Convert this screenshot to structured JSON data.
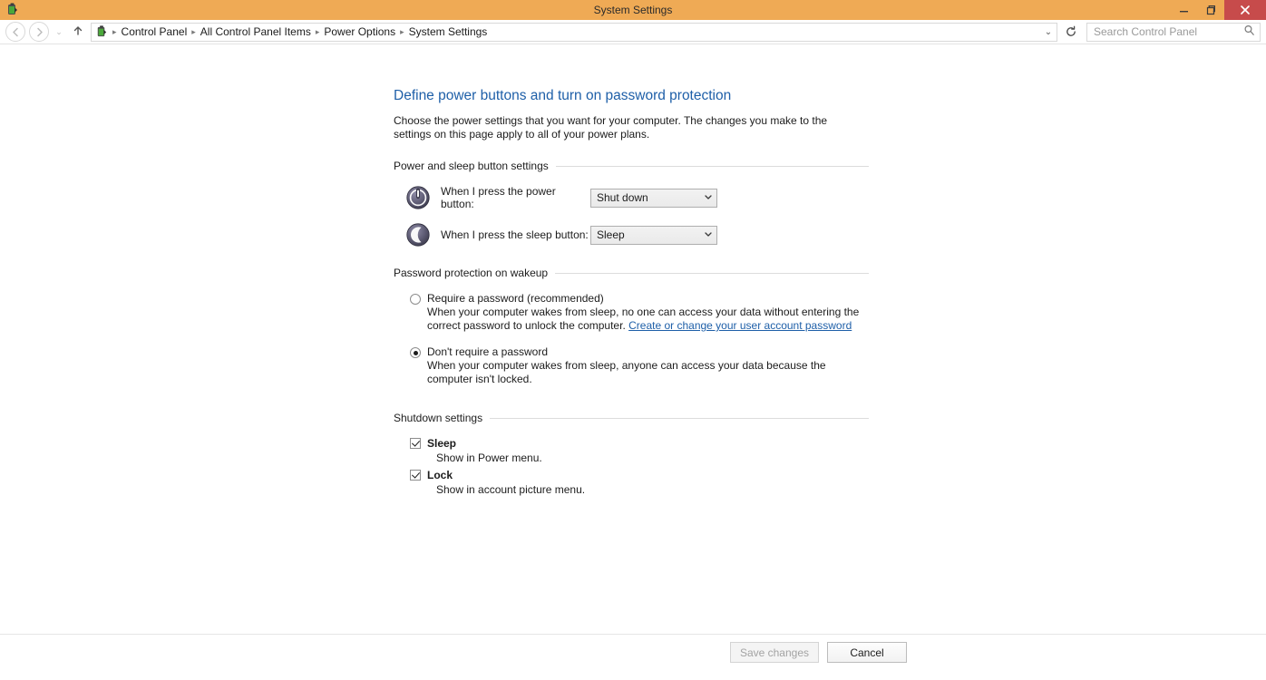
{
  "window": {
    "title": "System Settings",
    "icon": "battery-icon",
    "minimize_label": "—",
    "maximize_label": "❐",
    "close_label": "✕"
  },
  "nav": {
    "back_icon": "←",
    "forward_icon": "→",
    "recent_icon": "⌄",
    "up_icon": "↑",
    "refresh_icon": "⟳",
    "address_dropdown_icon": "⌄",
    "breadcrumb_icon": "battery-icon",
    "separator": "▸",
    "breadcrumbs": [
      "Control Panel",
      "All Control Panel Items",
      "Power Options",
      "System Settings"
    ]
  },
  "search": {
    "placeholder": "Search Control Panel",
    "value": "",
    "icon": "search-icon"
  },
  "page": {
    "heading": "Define power buttons and turn on password protection",
    "description": "Choose the power settings that you want for your computer. The changes you make to the settings on this page apply to all of your power plans."
  },
  "power_sleep_section": {
    "title": "Power and sleep button settings",
    "rows": [
      {
        "icon": "power-button-icon",
        "label": "When I press the power button:",
        "value": "Shut down",
        "chevron": "⌄"
      },
      {
        "icon": "sleep-moon-icon",
        "label": "When I press the sleep button:",
        "value": "Sleep",
        "chevron": "⌄"
      }
    ]
  },
  "password_section": {
    "title": "Password protection on wakeup",
    "options": [
      {
        "label": "Require a password (recommended)",
        "selected": false,
        "description_before": "When your computer wakes from sleep, no one can access your data without entering the correct password to unlock the computer. ",
        "link_text": "Create or change your user account password",
        "description_after": ""
      },
      {
        "label": "Don't require a password",
        "selected": true,
        "description_before": "When your computer wakes from sleep, anyone can access your data because the computer isn't locked.",
        "link_text": "",
        "description_after": ""
      }
    ]
  },
  "shutdown_section": {
    "title": "Shutdown settings",
    "items": [
      {
        "label": "Sleep",
        "checked": true,
        "description": "Show in Power menu."
      },
      {
        "label": "Lock",
        "checked": true,
        "description": "Show in account picture menu."
      }
    ]
  },
  "footer": {
    "save_label": "Save changes",
    "save_enabled": false,
    "cancel_label": "Cancel"
  },
  "colors": {
    "titlebar": "#efaa55",
    "close_button": "#c74b4b",
    "heading_blue": "#1e5fa8",
    "link_blue": "#1e5fa8"
  }
}
